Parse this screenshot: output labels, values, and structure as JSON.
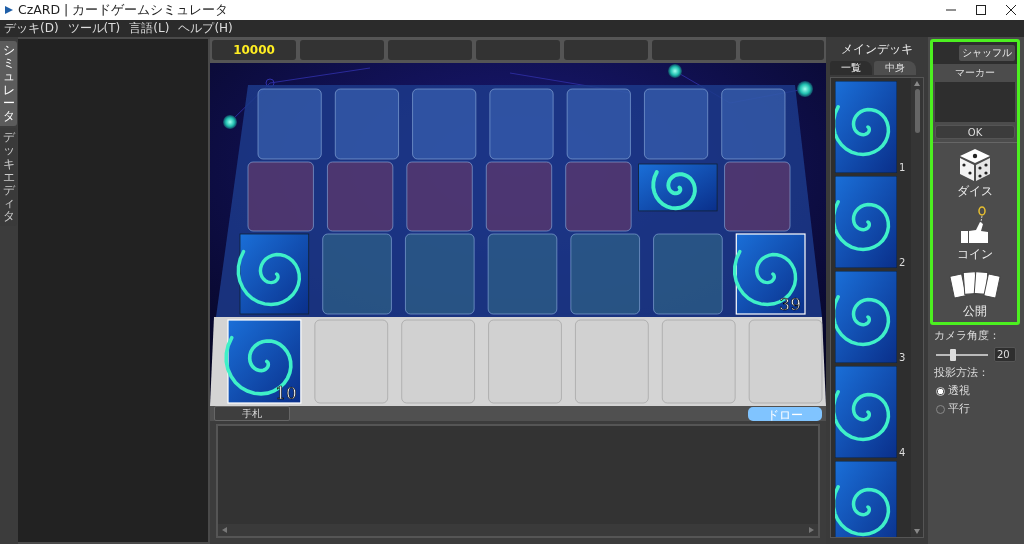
{
  "window": {
    "title": "CzARD | カードゲームシミュレータ"
  },
  "menu": [
    "デッキ(D)",
    "ツール(T)",
    "言語(L)",
    "ヘルプ(H)"
  ],
  "side_tabs": [
    {
      "label": "シミュレータ",
      "selected": true
    },
    {
      "label": "デッキエディタ",
      "selected": false
    }
  ],
  "counters": [
    {
      "value": "10000"
    }
  ],
  "field": {
    "rows": [
      {
        "kind": "blue",
        "slots": [
          {
            "kind": "empty"
          },
          {
            "kind": "empty"
          },
          {
            "kind": "empty"
          },
          {
            "kind": "empty"
          },
          {
            "kind": "empty"
          },
          {
            "kind": "empty"
          },
          {
            "kind": "empty"
          }
        ]
      },
      {
        "kind": "red",
        "slots": [
          {
            "kind": "empty"
          },
          {
            "kind": "empty"
          },
          {
            "kind": "empty"
          },
          {
            "kind": "empty"
          },
          {
            "kind": "empty"
          },
          {
            "kind": "sideways"
          },
          {
            "kind": "empty"
          }
        ]
      },
      {
        "kind": "teal",
        "slots": [
          {
            "kind": "upright"
          },
          {
            "kind": "empty"
          },
          {
            "kind": "empty"
          },
          {
            "kind": "empty"
          },
          {
            "kind": "empty"
          },
          {
            "kind": "empty"
          },
          {
            "kind": "upright",
            "count": "39"
          }
        ]
      },
      {
        "kind": "strip",
        "slots": [
          {
            "kind": "upright",
            "count": "10"
          },
          {
            "kind": "empty"
          },
          {
            "kind": "empty"
          },
          {
            "kind": "empty"
          },
          {
            "kind": "empty"
          },
          {
            "kind": "empty"
          },
          {
            "kind": "empty"
          }
        ]
      }
    ]
  },
  "hand": {
    "label": "手札",
    "draw_button": "ドロー"
  },
  "deck": {
    "title": "メインデッキ",
    "tabs": [
      {
        "label": "一覧",
        "selected": true
      },
      {
        "label": "中身",
        "selected": false
      }
    ],
    "cards": [
      {
        "number": "1"
      },
      {
        "number": "2"
      },
      {
        "number": "3"
      },
      {
        "number": "4"
      }
    ],
    "more_below": true
  },
  "tools": {
    "shuffle_button": "シャッフル",
    "marker_label": "マーカー",
    "ok_button": "OK",
    "actions": [
      {
        "kind": "dice",
        "label": "ダイス"
      },
      {
        "kind": "coin",
        "label": "コイン"
      },
      {
        "kind": "reveal",
        "label": "公開"
      }
    ]
  },
  "camera": {
    "label": "カメラ角度：",
    "level": 0.33,
    "value": "20"
  },
  "projection": {
    "label": "投影方法：",
    "options": [
      {
        "label": "透視",
        "selected": true
      },
      {
        "label": "平行",
        "selected": false
      }
    ]
  }
}
